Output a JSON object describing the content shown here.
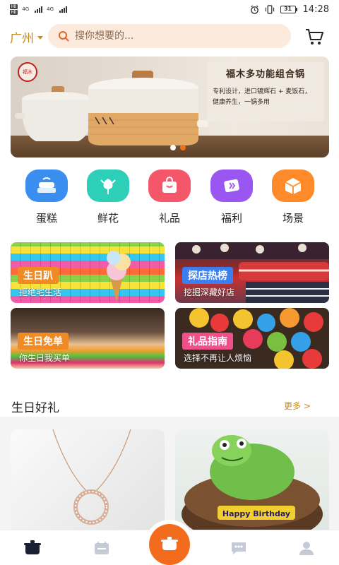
{
  "status_bar": {
    "sim_labels": [
      "HD",
      "HD"
    ],
    "signal_labels": [
      "4G",
      "4G"
    ],
    "battery": "31",
    "time": "14:28"
  },
  "header": {
    "city": "广州",
    "search_placeholder": "搜你想要的..."
  },
  "banner": {
    "title": "福木多功能组合锅",
    "subtitle_line1": "专利设计，进口镀辉石 + 麦饭石，",
    "subtitle_line2": "健康养生，一锅多用",
    "slide_count": 2,
    "active_slide": 2
  },
  "categories": [
    {
      "label": "蛋糕",
      "icon": "cake-icon",
      "color": "#3a8ef0"
    },
    {
      "label": "鲜花",
      "icon": "flower-icon",
      "color": "#2ecfb8"
    },
    {
      "label": "礼品",
      "icon": "gift-bag-icon",
      "color": "#f4566a"
    },
    {
      "label": "福利",
      "icon": "coupon-icon",
      "color": "#9a56f0"
    },
    {
      "label": "场景",
      "icon": "box-icon",
      "color": "#ff8a2a"
    }
  ],
  "feature_cards": [
    {
      "tag": "生日趴",
      "subtitle": "拒绝宅生活",
      "tag_color": "#f08a24"
    },
    {
      "tag": "探店热榜",
      "subtitle": "挖掘深藏好店",
      "tag_color": "#3a7ef0"
    },
    {
      "tag": "生日免单",
      "subtitle": "你生日我买单",
      "tag_color": "#f08a24"
    },
    {
      "tag": "礼品指南",
      "subtitle": "选择不再让人烦恼",
      "tag_color": "#f0508a"
    }
  ],
  "section": {
    "title": "生日好礼",
    "more": "更多 >"
  },
  "products": [
    {
      "name": "necklace-product"
    },
    {
      "name": "frog-cake-product",
      "cake_text": "Happy Birthday"
    }
  ],
  "bottom_nav": {
    "items": [
      "home-icon",
      "calendar-icon",
      "center-pot-icon",
      "chat-icon",
      "profile-icon"
    ],
    "accent": "#f36b1c"
  }
}
